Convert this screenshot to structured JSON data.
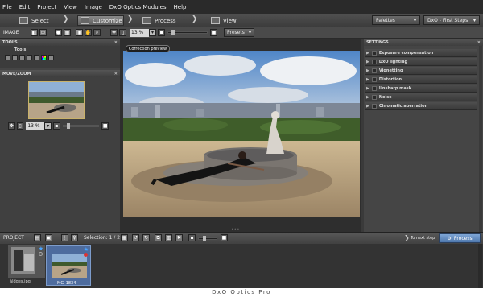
{
  "menu": [
    "File",
    "Edit",
    "Project",
    "View",
    "Image",
    "DxO Optics Modules",
    "Help"
  ],
  "workflow": {
    "tabs": [
      {
        "label": "Select",
        "active": false
      },
      {
        "label": "Customize",
        "active": true
      },
      {
        "label": "Process",
        "active": false
      },
      {
        "label": "View",
        "active": false
      }
    ],
    "palettes_label": "Palettes",
    "preset_label": "DxO - First Steps"
  },
  "toolbar": {
    "section_label": "IMAGE",
    "zoom_value": "13 %",
    "presets_label": "Presets"
  },
  "left_panel": {
    "tools_header": "TOOLS",
    "tools_group_label": "Tools",
    "move_zoom_header": "MOVE/ZOOM",
    "nav_zoom_value": "13 %"
  },
  "viewer": {
    "tooltip": "Correction preview"
  },
  "settings": {
    "header": "SETTINGS",
    "rows": [
      "Exposure compensation",
      "DxO lighting",
      "Vignetting",
      "Distortion",
      "Unsharp mask",
      "Noise",
      "Chromatic aberration"
    ]
  },
  "project_bar": {
    "label": "PROJECT",
    "selection": "Selection: 1 / 2",
    "next_step": "To next step",
    "process_button": "Process"
  },
  "filmstrip": [
    {
      "name": "àldges.jpg"
    },
    {
      "name": "MG_1834"
    }
  ],
  "caption": "DxO Optics Pro"
}
